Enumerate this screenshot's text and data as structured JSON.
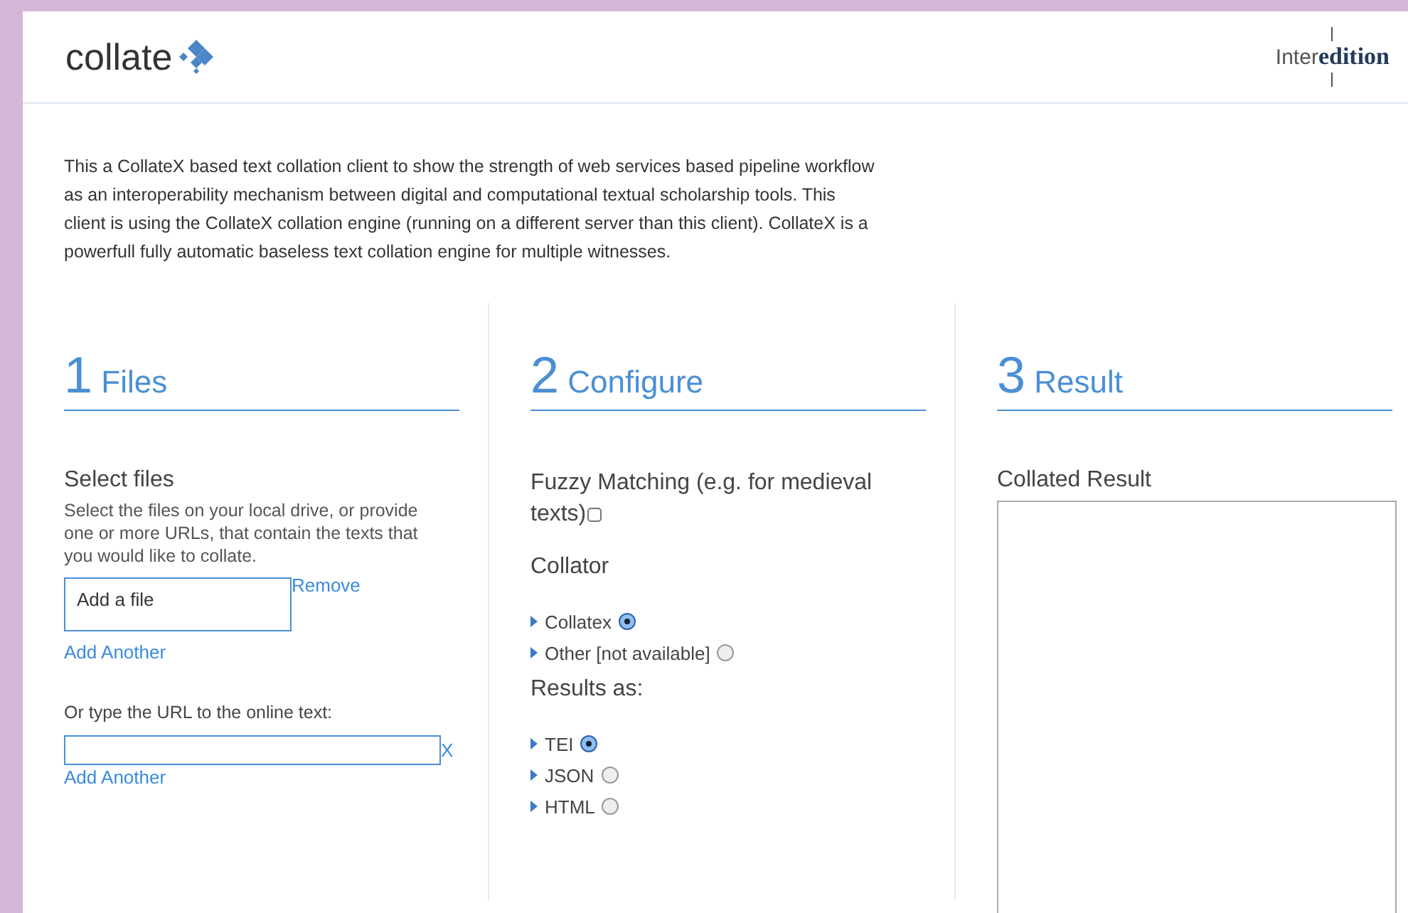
{
  "header": {
    "logo": "collate",
    "partner_light": "Inter",
    "partner_bold": "edition"
  },
  "intro": "This a CollateX based text collation client to show the strength of web services based pipeline workflow as an interoperability mechanism between digital and computational textual scholarship tools. This client is using the CollateX collation engine (running on a different server than this client). CollateX is a powerfull fully automatic baseless text collation engine for multiple witnesses.",
  "files": {
    "number": "1",
    "title": "Files",
    "heading": "Select files",
    "description": "Select the files on your local drive, or provide one or more URLs, that contain the texts that you would like to collate.",
    "file_field": {
      "placeholder": "Add a file"
    },
    "remove_link": "Remove",
    "add_another_file": "Add Another",
    "url_label": "Or type the URL to the online text:",
    "clear_link": "X",
    "add_another_url": "Add Another"
  },
  "configure": {
    "number": "2",
    "title": "Configure",
    "fuzzy_label": "Fuzzy Matching (e.g. for medieval texts)",
    "fuzzy_checked": false,
    "collator_heading": "Collator",
    "collators": [
      {
        "label": "Collatex",
        "selected": true
      },
      {
        "label": "Other [not available]",
        "selected": false
      }
    ],
    "results_heading": "Results as:",
    "formats": [
      {
        "label": "TEI",
        "selected": true
      },
      {
        "label": "JSON",
        "selected": false
      },
      {
        "label": "HTML",
        "selected": false
      }
    ]
  },
  "result": {
    "number": "3",
    "title": "Result",
    "heading": "Collated Result"
  }
}
